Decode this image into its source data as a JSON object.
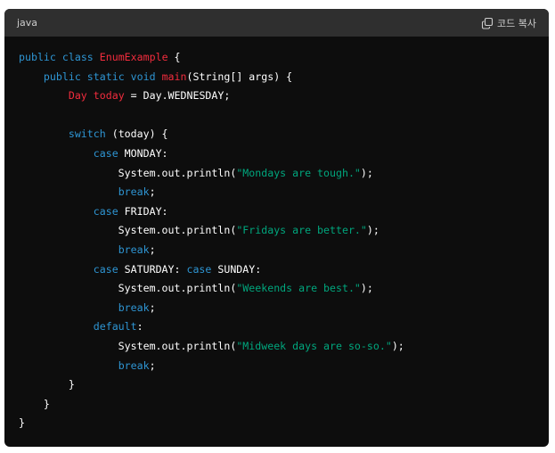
{
  "header": {
    "language": "java",
    "copy_label": "코드 복사"
  },
  "colors": {
    "background": "#0d0d0d",
    "header_background": "#2f2f2f",
    "keyword": "#2e95d3",
    "class_name": "#f22c3d",
    "string": "#00a67d",
    "plain": "#ffffff"
  },
  "icons": {
    "copy": "copy-icon"
  },
  "code": {
    "lines": [
      [
        {
          "t": "kw",
          "v": "public"
        },
        {
          "t": "plain",
          "v": " "
        },
        {
          "t": "kw",
          "v": "class"
        },
        {
          "t": "plain",
          "v": " "
        },
        {
          "t": "cls",
          "v": "EnumExample"
        },
        {
          "t": "plain",
          "v": " {"
        }
      ],
      [
        {
          "t": "plain",
          "v": "    "
        },
        {
          "t": "kw",
          "v": "public"
        },
        {
          "t": "plain",
          "v": " "
        },
        {
          "t": "kw",
          "v": "static"
        },
        {
          "t": "plain",
          "v": " "
        },
        {
          "t": "kw",
          "v": "void"
        },
        {
          "t": "plain",
          "v": " "
        },
        {
          "t": "cls",
          "v": "main"
        },
        {
          "t": "plain",
          "v": "(String[] args) {"
        }
      ],
      [
        {
          "t": "plain",
          "v": "        "
        },
        {
          "t": "cls",
          "v": "Day"
        },
        {
          "t": "plain",
          "v": " "
        },
        {
          "t": "cls",
          "v": "today"
        },
        {
          "t": "plain",
          "v": " = Day.WEDNESDAY;"
        }
      ],
      [],
      [
        {
          "t": "plain",
          "v": "        "
        },
        {
          "t": "kw",
          "v": "switch"
        },
        {
          "t": "plain",
          "v": " (today) {"
        }
      ],
      [
        {
          "t": "plain",
          "v": "            "
        },
        {
          "t": "kw",
          "v": "case"
        },
        {
          "t": "plain",
          "v": " MONDAY:"
        }
      ],
      [
        {
          "t": "plain",
          "v": "                System.out.println("
        },
        {
          "t": "str",
          "v": "\"Mondays are tough.\""
        },
        {
          "t": "plain",
          "v": ");"
        }
      ],
      [
        {
          "t": "plain",
          "v": "                "
        },
        {
          "t": "kw",
          "v": "break"
        },
        {
          "t": "plain",
          "v": ";"
        }
      ],
      [
        {
          "t": "plain",
          "v": "            "
        },
        {
          "t": "kw",
          "v": "case"
        },
        {
          "t": "plain",
          "v": " FRIDAY:"
        }
      ],
      [
        {
          "t": "plain",
          "v": "                System.out.println("
        },
        {
          "t": "str",
          "v": "\"Fridays are better.\""
        },
        {
          "t": "plain",
          "v": ");"
        }
      ],
      [
        {
          "t": "plain",
          "v": "                "
        },
        {
          "t": "kw",
          "v": "break"
        },
        {
          "t": "plain",
          "v": ";"
        }
      ],
      [
        {
          "t": "plain",
          "v": "            "
        },
        {
          "t": "kw",
          "v": "case"
        },
        {
          "t": "plain",
          "v": " SATURDAY: "
        },
        {
          "t": "kw",
          "v": "case"
        },
        {
          "t": "plain",
          "v": " SUNDAY:"
        }
      ],
      [
        {
          "t": "plain",
          "v": "                System.out.println("
        },
        {
          "t": "str",
          "v": "\"Weekends are best.\""
        },
        {
          "t": "plain",
          "v": ");"
        }
      ],
      [
        {
          "t": "plain",
          "v": "                "
        },
        {
          "t": "kw",
          "v": "break"
        },
        {
          "t": "plain",
          "v": ";"
        }
      ],
      [
        {
          "t": "plain",
          "v": "            "
        },
        {
          "t": "kw",
          "v": "default"
        },
        {
          "t": "plain",
          "v": ":"
        }
      ],
      [
        {
          "t": "plain",
          "v": "                System.out.println("
        },
        {
          "t": "str",
          "v": "\"Midweek days are so-so.\""
        },
        {
          "t": "plain",
          "v": ");"
        }
      ],
      [
        {
          "t": "plain",
          "v": "                "
        },
        {
          "t": "kw",
          "v": "break"
        },
        {
          "t": "plain",
          "v": ";"
        }
      ],
      [
        {
          "t": "plain",
          "v": "        }"
        }
      ],
      [
        {
          "t": "plain",
          "v": "    }"
        }
      ],
      [
        {
          "t": "plain",
          "v": "}"
        }
      ]
    ]
  }
}
